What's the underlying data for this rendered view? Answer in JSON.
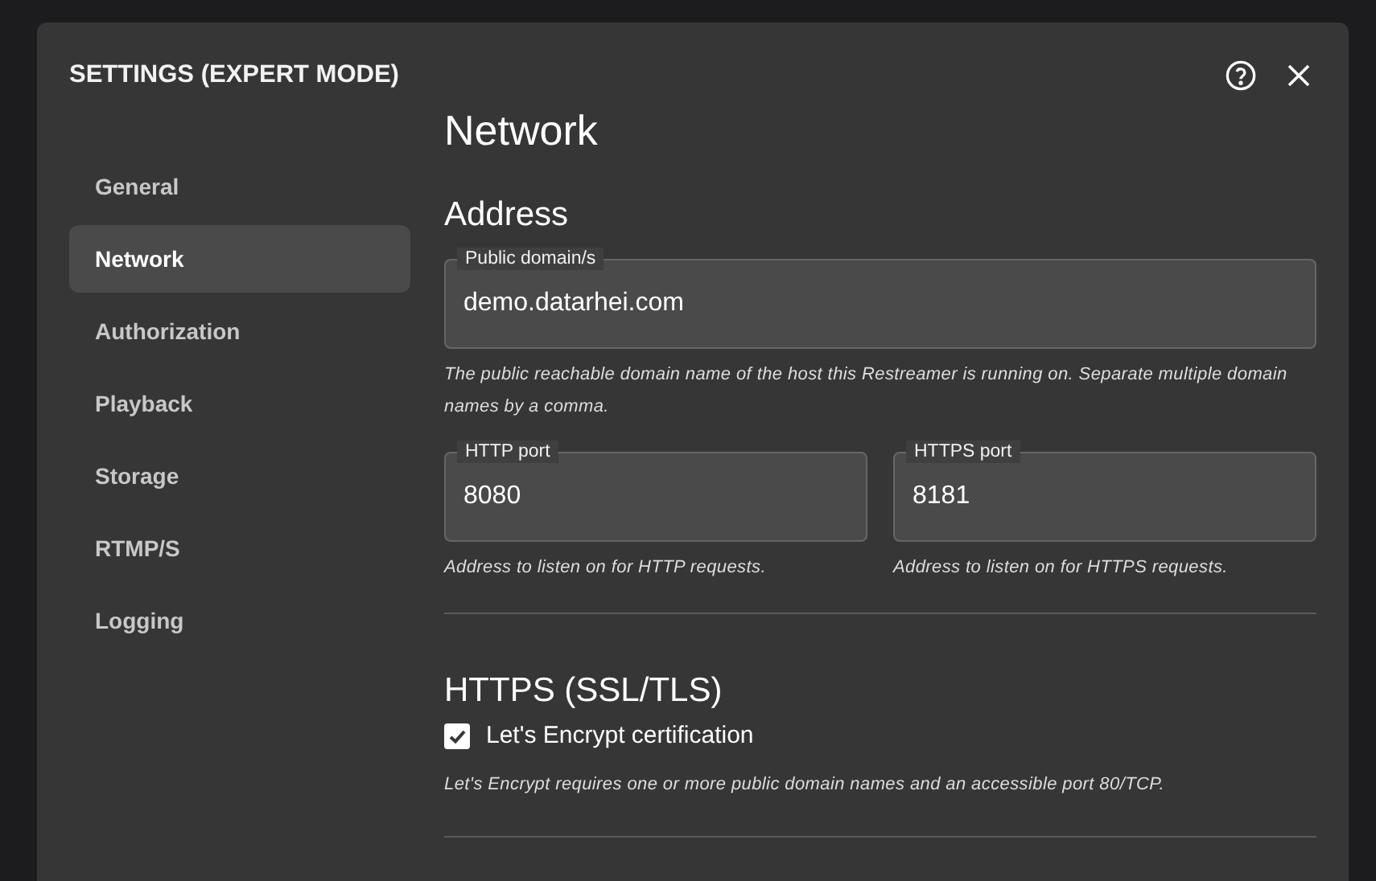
{
  "dialog": {
    "title": "SETTINGS (EXPERT MODE)"
  },
  "sidebar": {
    "items": [
      {
        "label": "General",
        "selected": false
      },
      {
        "label": "Network",
        "selected": true
      },
      {
        "label": "Authorization",
        "selected": false
      },
      {
        "label": "Playback",
        "selected": false
      },
      {
        "label": "Storage",
        "selected": false
      },
      {
        "label": "RTMP/S",
        "selected": false
      },
      {
        "label": "Logging",
        "selected": false
      }
    ]
  },
  "page_title": "Network",
  "address": {
    "heading": "Address",
    "domain": {
      "label": "Public domain/s",
      "value": "demo.datarhei.com",
      "help": "The public reachable domain name of the host this Restreamer is running on. Separate multiple domain names by a comma."
    },
    "ports": [
      {
        "label": "HTTP port",
        "value": "8080",
        "help": "Address to listen on for HTTP requests."
      },
      {
        "label": "HTTPS port",
        "value": "8181",
        "help": "Address to listen on for HTTPS requests."
      }
    ]
  },
  "https": {
    "heading": "HTTPS (SSL/TLS)",
    "checkbox": {
      "label": "Let's Encrypt certification",
      "checked": true
    },
    "help": "Let's Encrypt requires one or more public domain names and an accessible port 80/TCP."
  }
}
